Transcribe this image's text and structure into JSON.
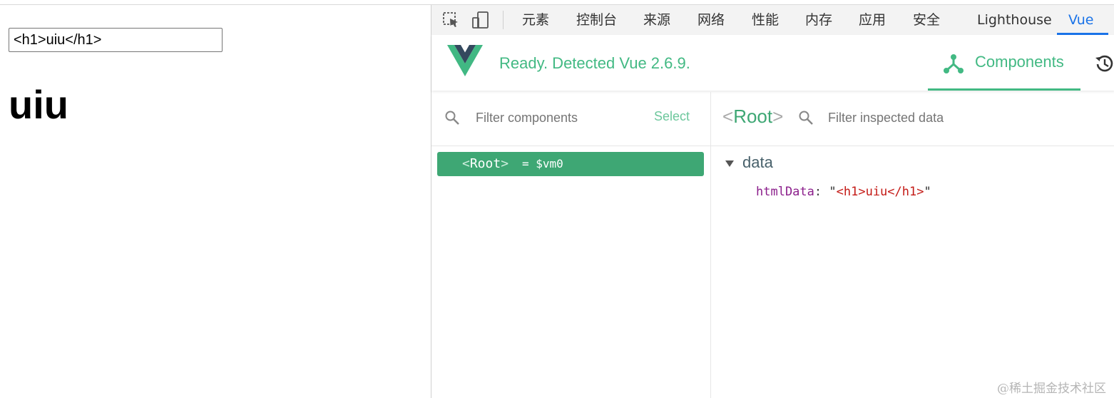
{
  "left": {
    "input_value": "<h1>uiu</h1>",
    "rendered_heading": "uiu"
  },
  "devtools": {
    "tabs": [
      {
        "label": "元素"
      },
      {
        "label": "控制台"
      },
      {
        "label": "来源"
      },
      {
        "label": "网络"
      },
      {
        "label": "性能"
      },
      {
        "label": "内存"
      },
      {
        "label": "应用"
      },
      {
        "label": "安全"
      },
      {
        "label": "Lighthouse"
      },
      {
        "label": "Vue",
        "active": true
      }
    ],
    "vue": {
      "status": "Ready. Detected Vue 2.6.9.",
      "components_tab": "Components",
      "filter_components_placeholder": "Filter components",
      "select_label": "Select",
      "tree_root": {
        "bracket_open": "<",
        "name": "Root",
        "bracket_close": ">",
        "vm": "= $vm0"
      },
      "inspector": {
        "title_bracket_open": "<",
        "title": "Root",
        "title_bracket_close": ">",
        "filter_placeholder": "Filter inspected data",
        "section": "data",
        "props": [
          {
            "key": "htmlData",
            "colon": ":",
            "quote_open": "\"",
            "value": "<h1>uiu</h1>",
            "quote_close": "\""
          }
        ]
      }
    },
    "colors": {
      "vue_green": "#42b983",
      "active_blue": "#1a73e8",
      "tree_bg": "#3ea774"
    },
    "icons": [
      "inspect-element-icon",
      "device-toggle-icon",
      "vue-logo",
      "components-icon",
      "history-icon",
      "search-icon"
    ]
  },
  "watermark": "@稀土掘金技术社区"
}
